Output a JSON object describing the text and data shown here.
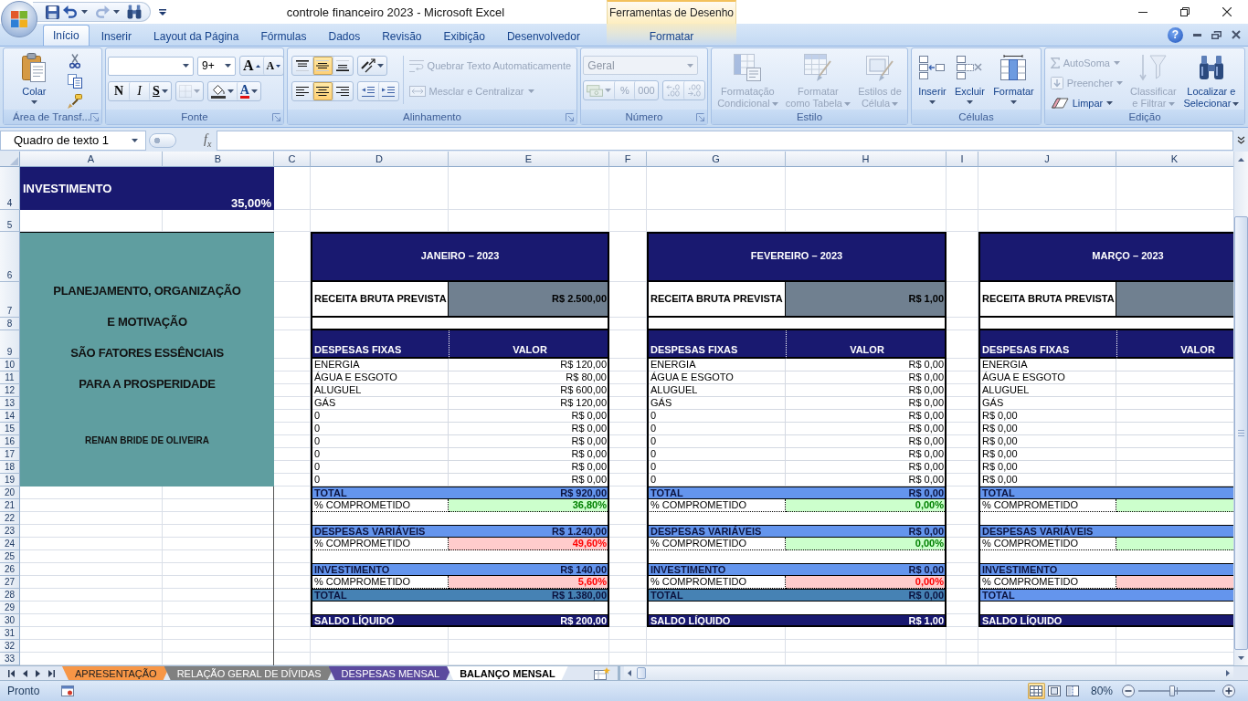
{
  "window": {
    "title": "controle financeiro 2023 - Microsoft Excel",
    "context_group": "Ferramentas de Desenho",
    "quick_access": [
      {
        "disabled": false
      },
      {
        "disabled": false,
        "dropdown": true
      },
      {
        "disabled": true,
        "dropdown": true
      },
      {
        "disabled": false
      }
    ]
  },
  "ribbon": {
    "tabs": [
      {
        "label": "Início",
        "selected": true,
        "kind": "standard"
      },
      {
        "label": "Inserir",
        "selected": false,
        "kind": "standard"
      },
      {
        "label": "Layout da Página",
        "selected": false,
        "kind": "standard"
      },
      {
        "label": "Fórmulas",
        "selected": false,
        "kind": "standard"
      },
      {
        "label": "Dados",
        "selected": false,
        "kind": "standard"
      },
      {
        "label": "Revisão",
        "selected": false,
        "kind": "standard"
      },
      {
        "label": "Exibição",
        "selected": false,
        "kind": "standard"
      },
      {
        "label": "Desenvolvedor",
        "selected": false,
        "kind": "standard"
      },
      {
        "label": "Formatar",
        "selected": false,
        "kind": "contextual"
      }
    ],
    "help_label": "?",
    "groups": [
      {
        "title": "Área de Transf...",
        "launcher": true,
        "controls": [
          {
            "kind": "large",
            "label": "Colar",
            "dropdown": true,
            "disabled": false
          },
          {
            "kind": "icon",
            "disabled": false
          },
          {
            "kind": "icon",
            "disabled": false
          },
          {
            "kind": "icon",
            "disabled": false
          }
        ]
      },
      {
        "title": "Fonte",
        "launcher": true,
        "controls": [
          {
            "kind": "combo",
            "dropdown": true,
            "disabled": false
          },
          {
            "kind": "combo",
            "value": "9+",
            "dropdown": true,
            "disabled": false
          },
          {
            "kind": "text",
            "label": "A",
            "disabled": false
          },
          {
            "kind": "text",
            "label": "A",
            "disabled": false
          },
          {
            "kind": "toggle",
            "label": "N",
            "pressed": false,
            "disabled": false
          },
          {
            "kind": "toggle",
            "label": "I",
            "pressed": false,
            "disabled": false
          },
          {
            "kind": "toggle",
            "label": "S",
            "pressed": false,
            "disabled": false,
            "dropdown": true
          },
          {
            "kind": "icon",
            "disabled": true,
            "dropdown": true
          },
          {
            "kind": "icon",
            "disabled": false,
            "dropdown": true
          },
          {
            "kind": "text",
            "label": "A",
            "disabled": false,
            "dropdown": true
          }
        ]
      },
      {
        "title": "Alinhamento",
        "launcher": true,
        "controls": [
          {
            "kind": "toggle",
            "pressed": false,
            "disabled": false
          },
          {
            "kind": "toggle",
            "pressed": true,
            "disabled": false
          },
          {
            "kind": "toggle",
            "pressed": false,
            "disabled": false
          },
          {
            "kind": "icon",
            "dropdown": true,
            "disabled": false
          },
          {
            "kind": "small",
            "label": "Quebrar Texto Automaticamente",
            "disabled": true
          },
          {
            "kind": "toggle",
            "pressed": false,
            "disabled": false
          },
          {
            "kind": "toggle",
            "pressed": true,
            "disabled": false
          },
          {
            "kind": "toggle",
            "pressed": false,
            "disabled": false
          },
          {
            "kind": "icon",
            "disabled": false
          },
          {
            "kind": "icon",
            "disabled": false
          },
          {
            "kind": "small",
            "label": "Mesclar e Centralizar",
            "dropdown": true,
            "disabled": true
          }
        ]
      },
      {
        "title": "Número",
        "launcher": true,
        "controls": [
          {
            "kind": "combo",
            "value": "Geral",
            "dropdown": true,
            "disabled": true
          },
          {
            "kind": "icon",
            "dropdown": true,
            "disabled": true
          },
          {
            "kind": "text",
            "label": "%",
            "disabled": true
          },
          {
            "kind": "text",
            "label": "000",
            "disabled": true
          },
          {
            "kind": "icon",
            "disabled": true
          },
          {
            "kind": "icon",
            "disabled": true
          }
        ]
      },
      {
        "title": "Estilo",
        "launcher": false,
        "controls": [
          {
            "kind": "large",
            "label": "Formatação\nCondicional",
            "dropdown": true,
            "disabled": true
          },
          {
            "kind": "large",
            "label": "Formatar\ncomo Tabela",
            "dropdown": true,
            "disabled": true
          },
          {
            "kind": "large",
            "label": "Estilos de\nCélula",
            "dropdown": true,
            "disabled": true
          }
        ]
      },
      {
        "title": "Células",
        "launcher": false,
        "controls": [
          {
            "kind": "large",
            "label": "Inserir",
            "dropdown": true,
            "disabled": false
          },
          {
            "kind": "large",
            "label": "Excluir",
            "dropdown": true,
            "disabled": false
          },
          {
            "kind": "large",
            "label": "Formatar",
            "dropdown": true,
            "disabled": false
          }
        ]
      },
      {
        "title": "Edição",
        "launcher": false,
        "controls": [
          {
            "kind": "small",
            "label": "AutoSoma",
            "dropdown": true,
            "disabled": true
          },
          {
            "kind": "small",
            "label": "Preencher",
            "dropdown": true,
            "disabled": true
          },
          {
            "kind": "small",
            "label": "Limpar",
            "dropdown": true,
            "disabled": false
          },
          {
            "kind": "large",
            "label": "Classificar\ne Filtrar",
            "dropdown": true,
            "disabled": true
          },
          {
            "kind": "large",
            "label": "Localizar e\nSelecionar",
            "dropdown": true,
            "disabled": false
          }
        ]
      }
    ]
  },
  "formula_bar": {
    "name_box": "Quadro de texto 1",
    "function_label": "f$_{x}$"
  },
  "sheet": {
    "column_headers": [
      "A",
      "B",
      "C",
      "D",
      "E",
      "F",
      "G",
      "H",
      "I",
      "J",
      "K"
    ],
    "row_headers": [
      "4",
      "5",
      "6",
      "7",
      "8",
      "9",
      "10",
      "11",
      "12",
      "13",
      "14",
      "15",
      "16",
      "17",
      "18",
      "19",
      "20",
      "21",
      "22",
      "23",
      "24",
      "25",
      "26",
      "27",
      "28",
      "29",
      "30",
      "31",
      "32",
      "33"
    ],
    "investment": {
      "label": "INVESTIMENTO",
      "value": "35,00%"
    },
    "motto": {
      "lines": [
        "PLANEJAMENTO, ORGANIZAÇÃO",
        "E MOTIVAÇÃO",
        "SÃO FATORES ESSÊNCIAIS",
        "PARA A PROSPERIDADE"
      ],
      "author": "RENAN BRIDE DE OLIVEIRA"
    },
    "months": [
      {
        "title": "JANEIRO – 2023",
        "revenue": {
          "label": "RECEITA BRUTA PREVISTA",
          "value": "R$ 2.500,00"
        },
        "header": {
          "label": "DESPESAS FIXAS",
          "value": "VALOR"
        },
        "items": [
          {
            "name": "ENERGIA",
            "value": "R$ 120,00"
          },
          {
            "name": "ÁGUA E ESGOTO",
            "value": "R$ 80,00"
          },
          {
            "name": "ALUGUEL",
            "value": "R$ 600,00"
          },
          {
            "name": "GÁS",
            "value": "R$ 120,00"
          },
          {
            "name": "0",
            "value": "R$ 0,00"
          },
          {
            "name": "0",
            "value": "R$ 0,00"
          },
          {
            "name": "0",
            "value": "R$ 0,00"
          },
          {
            "name": "0",
            "value": "R$ 0,00"
          },
          {
            "name": "0",
            "value": "R$ 0,00"
          },
          {
            "name": "0",
            "value": "R$ 0,00"
          }
        ],
        "summary": [
          {
            "kind": "bar",
            "label": "TOTAL",
            "value": "R$ 920,00",
            "color": "#6495ed"
          },
          {
            "kind": "percent",
            "label": "% COMPROMETIDO",
            "value": "36,80%",
            "over_limit": false
          },
          {
            "kind": "blank"
          },
          {
            "kind": "bar",
            "label": "DESPESAS VARIÁVEIS",
            "value": "R$ 1.240,00",
            "color": "#6495ed"
          },
          {
            "kind": "percent",
            "label": "% COMPROMETIDO",
            "value": "49,60%",
            "over_limit": true
          },
          {
            "kind": "blank"
          },
          {
            "kind": "bar",
            "label": "INVESTIMENTO",
            "value": "R$ 140,00",
            "color": "#6495ed"
          },
          {
            "kind": "percent",
            "label": "% COMPROMETIDO",
            "value": "5,60%",
            "over_limit": true
          },
          {
            "kind": "bar",
            "label": "TOTAL",
            "value": "R$ 1.380,00",
            "color": "#4682b4"
          },
          {
            "kind": "blank"
          },
          {
            "kind": "balance",
            "label": "SALDO LÍQUIDO",
            "value": "R$ 200,00"
          }
        ]
      },
      {
        "title": "FEVEREIRO – 2023",
        "revenue": {
          "label": "RECEITA BRUTA PREVISTA",
          "value": "R$ 1,00"
        },
        "header": {
          "label": "DESPESAS FIXAS",
          "value": "VALOR"
        },
        "items": [
          {
            "name": "ENERGIA",
            "value": "R$ 0,00"
          },
          {
            "name": "ÁGUA E ESGOTO",
            "value": "R$ 0,00"
          },
          {
            "name": "ALUGUEL",
            "value": "R$ 0,00"
          },
          {
            "name": "GÁS",
            "value": "R$ 0,00"
          },
          {
            "name": "0",
            "value": "R$ 0,00"
          },
          {
            "name": "0",
            "value": "R$ 0,00"
          },
          {
            "name": "0",
            "value": "R$ 0,00"
          },
          {
            "name": "0",
            "value": "R$ 0,00"
          },
          {
            "name": "0",
            "value": "R$ 0,00"
          },
          {
            "name": "0",
            "value": "R$ 0,00"
          }
        ],
        "summary": [
          {
            "kind": "bar",
            "label": "TOTAL",
            "value": "R$ 0,00",
            "color": "#6495ed"
          },
          {
            "kind": "percent",
            "label": "% COMPROMETIDO",
            "value": "0,00%",
            "over_limit": false
          },
          {
            "kind": "blank"
          },
          {
            "kind": "bar",
            "label": "DESPESAS VARIÁVEIS",
            "value": "R$ 0,00",
            "color": "#6495ed"
          },
          {
            "kind": "percent",
            "label": "% COMPROMETIDO",
            "value": "0,00%",
            "over_limit": false
          },
          {
            "kind": "blank"
          },
          {
            "kind": "bar",
            "label": "INVESTIMENTO",
            "value": "R$ 0,00",
            "color": "#6495ed"
          },
          {
            "kind": "percent",
            "label": "% COMPROMETIDO",
            "value": "0,00%",
            "over_limit": true
          },
          {
            "kind": "bar",
            "label": "TOTAL",
            "value": "R$ 0,00",
            "color": "#4682b4"
          },
          {
            "kind": "blank"
          },
          {
            "kind": "balance",
            "label": "SALDO LÍQUIDO",
            "value": "R$ 1,00"
          }
        ]
      },
      {
        "title": "MARÇO – 2023",
        "revenue": {
          "label": "RECEITA BRUTA PREVISTA"
        },
        "header": {
          "label": "DESPESAS FIXAS",
          "value": "VALOR"
        },
        "items": [
          {
            "name": "ENERGIA"
          },
          {
            "name": "ÁGUA E ESGOTO"
          },
          {
            "name": "ALUGUEL"
          },
          {
            "name": "GÁS"
          },
          {
            "name": "R$ 0,00"
          },
          {
            "name": "R$ 0,00"
          },
          {
            "name": "R$ 0,00"
          },
          {
            "name": "R$ 0,00"
          },
          {
            "name": "R$ 0,00"
          },
          {
            "name": "R$ 0,00"
          }
        ],
        "summary": [
          {
            "kind": "bar",
            "label": "TOTAL",
            "color": "#6495ed"
          },
          {
            "kind": "percent",
            "label": "% COMPROMETIDO",
            "over_limit": false
          },
          {
            "kind": "blank"
          },
          {
            "kind": "bar",
            "label": "DESPESAS VARIÁVEIS",
            "color": "#6495ed"
          },
          {
            "kind": "percent",
            "label": "% COMPROMETIDO",
            "over_limit": false
          },
          {
            "kind": "blank"
          },
          {
            "kind": "bar",
            "label": "INVESTIMENTO",
            "color": "#6495ed"
          },
          {
            "kind": "percent",
            "label": "% COMPROMETIDO",
            "over_limit": true
          },
          {
            "kind": "bar",
            "label": "TOTAL",
            "color": "#6495ed"
          },
          {
            "kind": "blank"
          },
          {
            "kind": "balance",
            "label": "SALDO LÍQUIDO"
          }
        ]
      }
    ]
  },
  "sheet_tabs": [
    {
      "label": "APRESENTAÇÃO",
      "selected": false,
      "color": "#f79646"
    },
    {
      "label": "RELAÇÃO GERAL DE DÍVIDAS",
      "selected": false,
      "color": "#808080"
    },
    {
      "label": "DESPESAS MENSAL",
      "selected": false,
      "color": "#5b4a9e"
    },
    {
      "label": "BALANÇO MENSAL",
      "selected": true
    }
  ],
  "status_bar": {
    "status": "Pronto",
    "views": [
      {
        "selected": true
      },
      {
        "selected": false
      },
      {
        "selected": false
      }
    ],
    "zoom": {
      "label": "80%",
      "level": 0.44
    }
  }
}
